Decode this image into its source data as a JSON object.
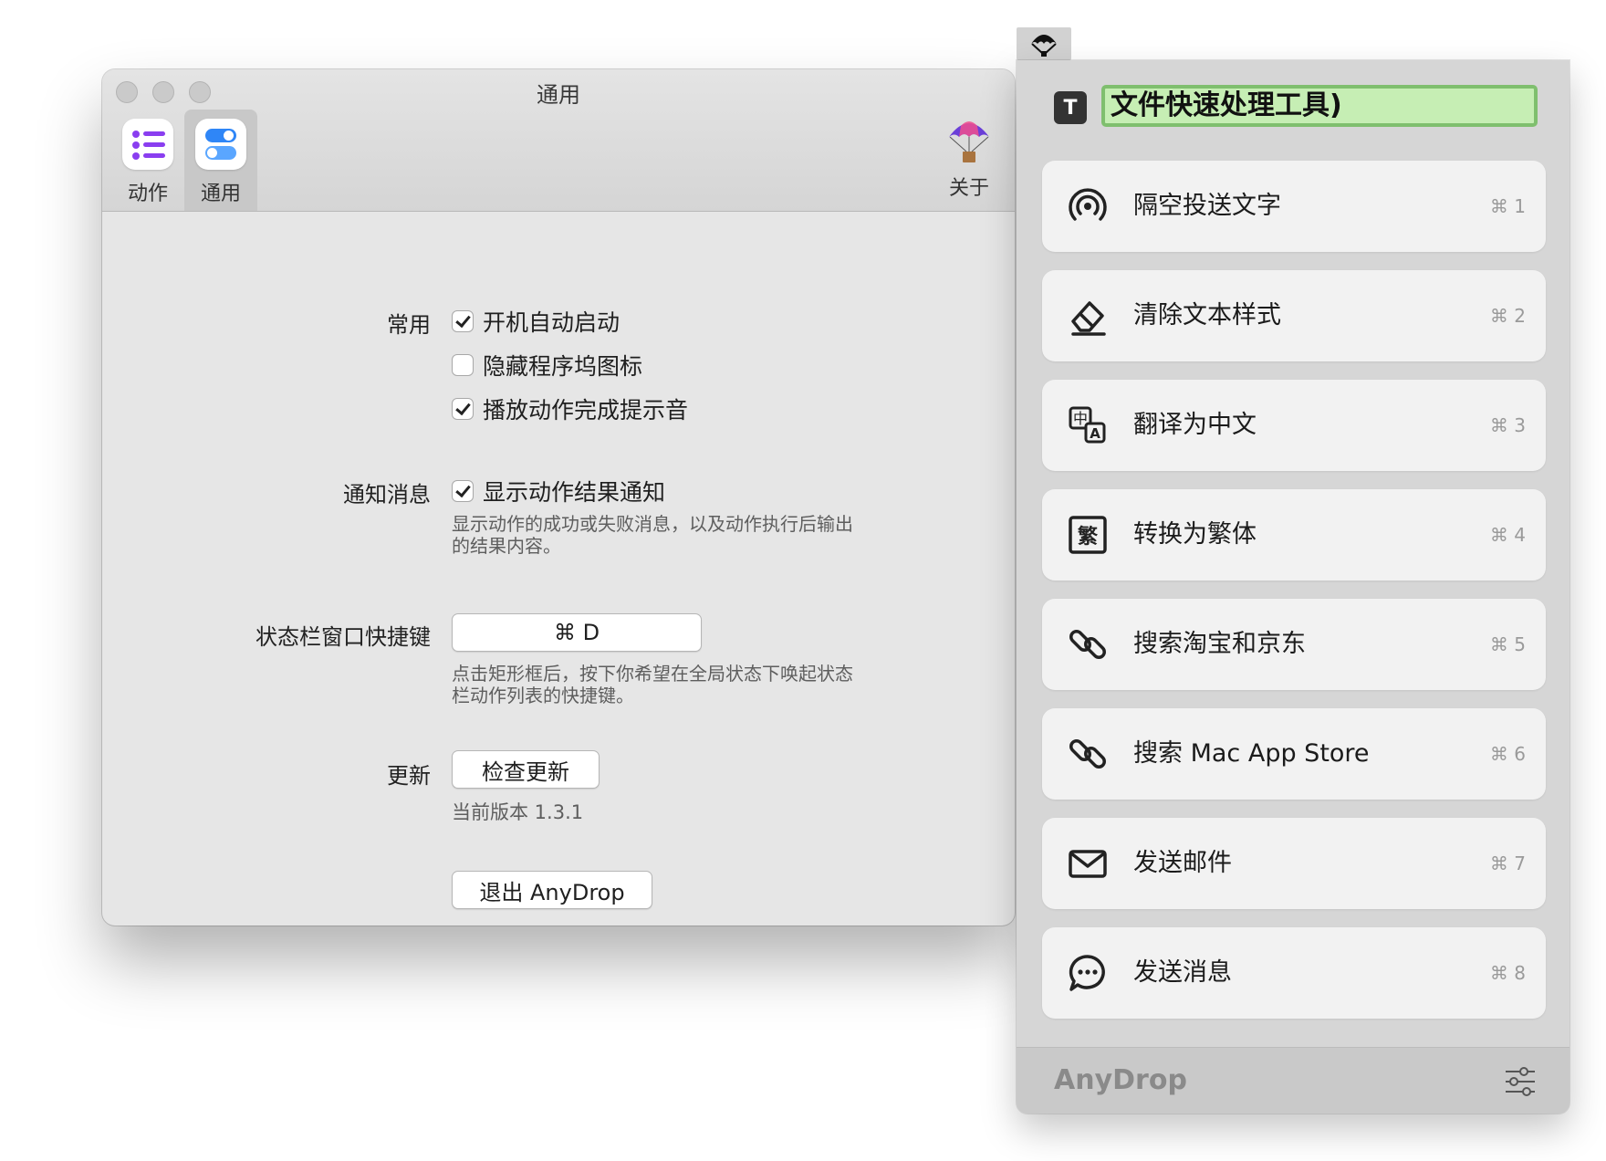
{
  "prefs_window": {
    "title": "通用",
    "toolbar": {
      "actions_label": "动作",
      "general_label": "通用",
      "about_label": "关于"
    },
    "common": {
      "label": "常用",
      "options": [
        {
          "text": "开机自动启动",
          "checked": true
        },
        {
          "text": "隐藏程序坞图标",
          "checked": false
        },
        {
          "text": "播放动作完成提示音",
          "checked": true
        }
      ]
    },
    "notifications": {
      "label": "通知消息",
      "option_text": "显示动作结果通知",
      "checked": true,
      "help": "显示动作的成功或失败消息，以及动作执行后输出的结果内容。"
    },
    "shortcut": {
      "label": "状态栏窗口快捷键",
      "value": "⌘ D",
      "help": "点击矩形框后，按下你希望在全局状态下唤起状态栏动作列表的快捷键。"
    },
    "update": {
      "label": "更新",
      "button": "检查更新",
      "version": "当前版本 1.3.1"
    },
    "quit_button": "退出 AnyDrop"
  },
  "panel": {
    "badge": "T",
    "name_value": "文件快速处理工具)",
    "items": [
      {
        "label": "隔空投送文字",
        "shortcut": "⌘ 1",
        "icon": "airdrop-icon"
      },
      {
        "label": "清除文本样式",
        "shortcut": "⌘ 2",
        "icon": "eraser-icon"
      },
      {
        "label": "翻译为中文",
        "shortcut": "⌘ 3",
        "icon": "translate-icon"
      },
      {
        "label": "转换为繁体",
        "shortcut": "⌘ 4",
        "icon": "traditional-chinese-icon"
      },
      {
        "label": "搜索淘宝和京东",
        "shortcut": "⌘ 5",
        "icon": "link-icon"
      },
      {
        "label": "搜索 Mac App Store",
        "shortcut": "⌘ 6",
        "icon": "link-icon"
      },
      {
        "label": "发送邮件",
        "shortcut": "⌘ 7",
        "icon": "envelope-icon"
      },
      {
        "label": "发送消息",
        "shortcut": "⌘ 8",
        "icon": "message-icon"
      }
    ],
    "footer_brand": "AnyDrop"
  },
  "colors": {
    "accent_purple": "#8a3ef0",
    "accent_blue": "#2f86f7",
    "name_field_green": "#c6eeb4",
    "name_field_border": "#7fbf6e"
  }
}
